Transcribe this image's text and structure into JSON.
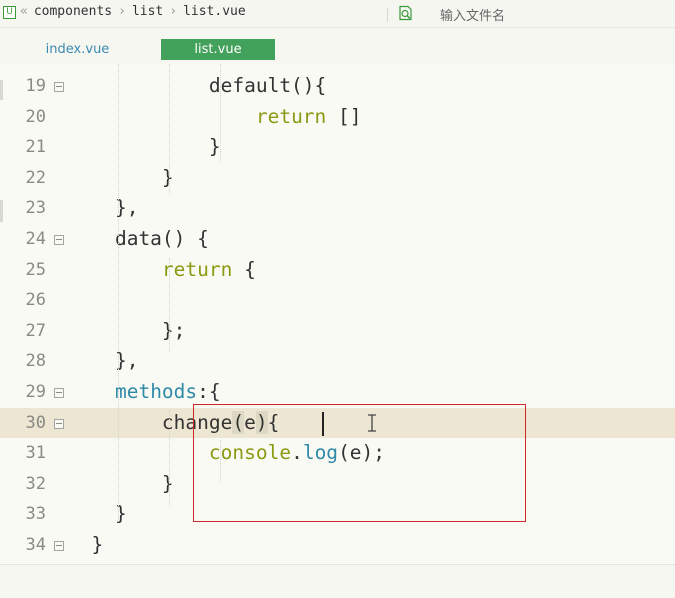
{
  "breadcrumb": {
    "app_icon_glyph": "U",
    "lead_separator": "«",
    "separator": "›",
    "items": [
      "components",
      "list",
      "list.vue"
    ]
  },
  "search": {
    "placeholder": "输入文件名"
  },
  "tabs": [
    {
      "label": "index.vue",
      "active": false
    },
    {
      "label": "list.vue",
      "active": true
    }
  ],
  "editor": {
    "current_line": 30,
    "lines": [
      {
        "number": "19",
        "fold": true,
        "tokens": [
          {
            "t": "            default(){",
            "c": ""
          }
        ]
      },
      {
        "number": "20",
        "fold": false,
        "tokens": [
          {
            "t": "                ",
            "c": ""
          },
          {
            "t": "return",
            "c": "kw"
          },
          {
            "t": " []",
            "c": ""
          }
        ]
      },
      {
        "number": "21",
        "fold": false,
        "tokens": [
          {
            "t": "            }",
            "c": ""
          }
        ]
      },
      {
        "number": "22",
        "fold": false,
        "tokens": [
          {
            "t": "        }",
            "c": ""
          }
        ]
      },
      {
        "number": "23",
        "fold": false,
        "tokens": [
          {
            "t": "    },",
            "c": ""
          }
        ]
      },
      {
        "number": "24",
        "fold": true,
        "tokens": [
          {
            "t": "    data() {",
            "c": ""
          }
        ]
      },
      {
        "number": "25",
        "fold": false,
        "tokens": [
          {
            "t": "        ",
            "c": ""
          },
          {
            "t": "return",
            "c": "kw"
          },
          {
            "t": " {",
            "c": ""
          }
        ]
      },
      {
        "number": "26",
        "fold": false,
        "tokens": [
          {
            "t": "",
            "c": ""
          }
        ]
      },
      {
        "number": "27",
        "fold": false,
        "tokens": [
          {
            "t": "        };",
            "c": ""
          }
        ]
      },
      {
        "number": "28",
        "fold": false,
        "tokens": [
          {
            "t": "    },",
            "c": ""
          }
        ]
      },
      {
        "number": "29",
        "fold": true,
        "tokens": [
          {
            "t": "    ",
            "c": ""
          },
          {
            "t": "methods",
            "c": "prop"
          },
          {
            "t": ":{",
            "c": ""
          }
        ]
      },
      {
        "number": "30",
        "fold": true,
        "tokens": [
          {
            "t": "        change",
            "c": ""
          },
          {
            "t": "(",
            "c": "bracket-hl"
          },
          {
            "t": "e",
            "c": ""
          },
          {
            "t": ")",
            "c": "bracket-hl"
          },
          {
            "t": "{",
            "c": ""
          }
        ]
      },
      {
        "number": "31",
        "fold": false,
        "tokens": [
          {
            "t": "            ",
            "c": ""
          },
          {
            "t": "console",
            "c": "kw"
          },
          {
            "t": ".",
            "c": ""
          },
          {
            "t": "log",
            "c": "prop"
          },
          {
            "t": "(e);",
            "c": ""
          }
        ]
      },
      {
        "number": "32",
        "fold": false,
        "tokens": [
          {
            "t": "        }",
            "c": ""
          }
        ]
      },
      {
        "number": "33",
        "fold": false,
        "tokens": [
          {
            "t": "    }",
            "c": ""
          }
        ]
      },
      {
        "number": "34",
        "fold": true,
        "tokens": [
          {
            "t": "  }",
            "c": ""
          }
        ]
      }
    ]
  },
  "colors": {
    "keyword": "#8a9a12",
    "property": "#2f8aa8",
    "active_tab": "#42a15a",
    "current_line": "#ece6d2",
    "annotation_box": "#cc2a2a"
  }
}
